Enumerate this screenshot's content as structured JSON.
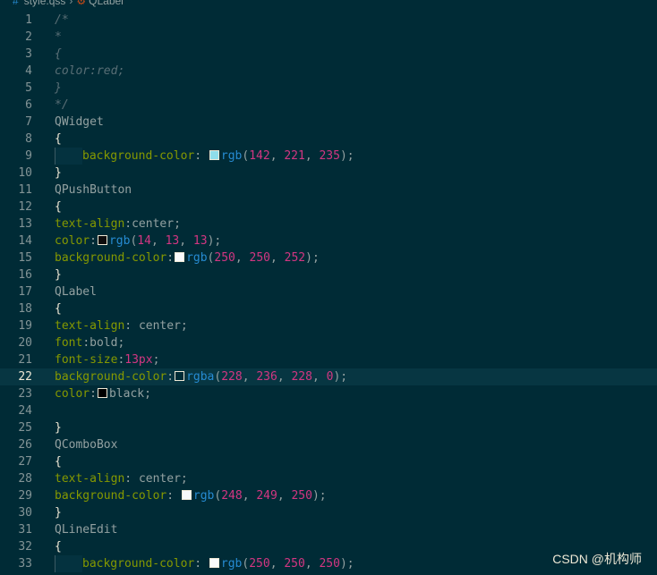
{
  "breadcrumb": {
    "hash": "#",
    "file": "style.qss",
    "symbol": "QLabel"
  },
  "watermark": "CSDN @机构师",
  "colors": {
    "background": "#002b36",
    "current_line": "#073642",
    "comment": "#586e75",
    "property": "#859900",
    "function": "#268bd2",
    "number": "#d33682"
  },
  "lines": [
    {
      "n": "1",
      "tokens": [
        {
          "t": "/*",
          "c": "comment"
        }
      ]
    },
    {
      "n": "2",
      "tokens": [
        {
          "t": "*",
          "c": "comment"
        }
      ]
    },
    {
      "n": "3",
      "tokens": [
        {
          "t": "{",
          "c": "comment"
        }
      ]
    },
    {
      "n": "4",
      "tokens": [
        {
          "t": "color:red;",
          "c": "comment"
        }
      ]
    },
    {
      "n": "5",
      "tokens": [
        {
          "t": "}",
          "c": "comment"
        }
      ]
    },
    {
      "n": "6",
      "tokens": [
        {
          "t": "*/",
          "c": "comment"
        }
      ]
    },
    {
      "n": "7",
      "tokens": [
        {
          "t": "QWidget",
          "c": "sel"
        }
      ]
    },
    {
      "n": "8",
      "tokens": [
        {
          "t": "{",
          "c": "brace"
        }
      ]
    },
    {
      "n": "9",
      "indent": true,
      "tokens": [
        {
          "t": "background-color",
          "c": "prop"
        },
        {
          "t": ": ",
          "c": "punc"
        },
        {
          "swatch": "#8eddeb"
        },
        {
          "t": "rgb",
          "c": "fn"
        },
        {
          "t": "(",
          "c": "punc"
        },
        {
          "t": "142",
          "c": "num"
        },
        {
          "t": ", ",
          "c": "punc"
        },
        {
          "t": "221",
          "c": "num"
        },
        {
          "t": ", ",
          "c": "punc"
        },
        {
          "t": "235",
          "c": "num"
        },
        {
          "t": ");",
          "c": "punc"
        }
      ]
    },
    {
      "n": "10",
      "tokens": [
        {
          "t": "}",
          "c": "brace"
        }
      ]
    },
    {
      "n": "11",
      "tokens": [
        {
          "t": "QPushButton",
          "c": "sel"
        }
      ]
    },
    {
      "n": "12",
      "tokens": [
        {
          "t": "{",
          "c": "brace"
        }
      ]
    },
    {
      "n": "13",
      "tokens": [
        {
          "t": "text-align",
          "c": "prop"
        },
        {
          "t": ":",
          "c": "punc"
        },
        {
          "t": "center",
          "c": "val"
        },
        {
          "t": ";",
          "c": "punc"
        }
      ]
    },
    {
      "n": "14",
      "tokens": [
        {
          "t": "color",
          "c": "prop"
        },
        {
          "t": ":",
          "c": "punc"
        },
        {
          "swatch": "#0e0d0d"
        },
        {
          "t": "rgb",
          "c": "fn"
        },
        {
          "t": "(",
          "c": "punc"
        },
        {
          "t": "14",
          "c": "num"
        },
        {
          "t": ", ",
          "c": "punc"
        },
        {
          "t": "13",
          "c": "num"
        },
        {
          "t": ", ",
          "c": "punc"
        },
        {
          "t": "13",
          "c": "num"
        },
        {
          "t": ");",
          "c": "punc"
        }
      ]
    },
    {
      "n": "15",
      "tokens": [
        {
          "t": "background-color",
          "c": "prop"
        },
        {
          "t": ":",
          "c": "punc"
        },
        {
          "swatch": "#fafafc"
        },
        {
          "t": "rgb",
          "c": "fn"
        },
        {
          "t": "(",
          "c": "punc"
        },
        {
          "t": "250",
          "c": "num"
        },
        {
          "t": ", ",
          "c": "punc"
        },
        {
          "t": "250",
          "c": "num"
        },
        {
          "t": ", ",
          "c": "punc"
        },
        {
          "t": "252",
          "c": "num"
        },
        {
          "t": ");",
          "c": "punc"
        }
      ]
    },
    {
      "n": "16",
      "tokens": [
        {
          "t": "}",
          "c": "brace"
        }
      ]
    },
    {
      "n": "17",
      "tokens": [
        {
          "t": "QLabel",
          "c": "sel"
        }
      ]
    },
    {
      "n": "18",
      "tokens": [
        {
          "t": "{",
          "c": "brace"
        }
      ]
    },
    {
      "n": "19",
      "tokens": [
        {
          "t": "text-align",
          "c": "prop"
        },
        {
          "t": ": ",
          "c": "punc"
        },
        {
          "t": "center",
          "c": "val"
        },
        {
          "t": ";",
          "c": "punc"
        }
      ]
    },
    {
      "n": "20",
      "tokens": [
        {
          "t": "font",
          "c": "prop"
        },
        {
          "t": ":",
          "c": "punc"
        },
        {
          "t": "bold",
          "c": "val"
        },
        {
          "t": ";",
          "c": "punc"
        }
      ]
    },
    {
      "n": "21",
      "tokens": [
        {
          "t": "font-size",
          "c": "prop"
        },
        {
          "t": ":",
          "c": "punc"
        },
        {
          "t": "13px",
          "c": "num"
        },
        {
          "t": ";",
          "c": "punc"
        }
      ]
    },
    {
      "n": "22",
      "current": true,
      "tokens": [
        {
          "t": "background-color",
          "c": "prop"
        },
        {
          "t": ":",
          "c": "punc"
        },
        {
          "swatch": "#002b36"
        },
        {
          "t": "rgba",
          "c": "fn"
        },
        {
          "t": "(",
          "c": "punc"
        },
        {
          "t": "228",
          "c": "num"
        },
        {
          "t": ", ",
          "c": "punc"
        },
        {
          "t": "236",
          "c": "num"
        },
        {
          "t": ", ",
          "c": "punc"
        },
        {
          "t": "228",
          "c": "num"
        },
        {
          "t": ", ",
          "c": "punc"
        },
        {
          "t": "0",
          "c": "num"
        },
        {
          "t": ");",
          "c": "punc"
        }
      ]
    },
    {
      "n": "23",
      "tokens": [
        {
          "t": "color",
          "c": "prop"
        },
        {
          "t": ":",
          "c": "punc"
        },
        {
          "swatch": "#000000"
        },
        {
          "t": "black",
          "c": "val"
        },
        {
          "t": ";",
          "c": "punc"
        }
      ]
    },
    {
      "n": "24",
      "tokens": []
    },
    {
      "n": "25",
      "tokens": [
        {
          "t": "}",
          "c": "brace"
        }
      ]
    },
    {
      "n": "26",
      "tokens": [
        {
          "t": "QComboBox",
          "c": "sel"
        }
      ]
    },
    {
      "n": "27",
      "tokens": [
        {
          "t": "{",
          "c": "brace"
        }
      ]
    },
    {
      "n": "28",
      "tokens": [
        {
          "t": "text-align",
          "c": "prop"
        },
        {
          "t": ": ",
          "c": "punc"
        },
        {
          "t": "center",
          "c": "val"
        },
        {
          "t": ";",
          "c": "punc"
        }
      ]
    },
    {
      "n": "29",
      "tokens": [
        {
          "t": "background-color",
          "c": "prop"
        },
        {
          "t": ": ",
          "c": "punc"
        },
        {
          "swatch": "#f8f9fa"
        },
        {
          "t": "rgb",
          "c": "fn"
        },
        {
          "t": "(",
          "c": "punc"
        },
        {
          "t": "248",
          "c": "num"
        },
        {
          "t": ", ",
          "c": "punc"
        },
        {
          "t": "249",
          "c": "num"
        },
        {
          "t": ", ",
          "c": "punc"
        },
        {
          "t": "250",
          "c": "num"
        },
        {
          "t": ");",
          "c": "punc"
        }
      ]
    },
    {
      "n": "30",
      "tokens": [
        {
          "t": "}",
          "c": "brace"
        }
      ]
    },
    {
      "n": "31",
      "tokens": [
        {
          "t": "QLineEdit",
          "c": "sel"
        }
      ]
    },
    {
      "n": "32",
      "tokens": [
        {
          "t": "{",
          "c": "brace"
        }
      ]
    },
    {
      "n": "33",
      "indent": true,
      "tokens": [
        {
          "t": "background-color",
          "c": "prop"
        },
        {
          "t": ": ",
          "c": "punc"
        },
        {
          "swatch": "#fafafa"
        },
        {
          "t": "rgb",
          "c": "fn"
        },
        {
          "t": "(",
          "c": "punc"
        },
        {
          "t": "250",
          "c": "num"
        },
        {
          "t": ", ",
          "c": "punc"
        },
        {
          "t": "250",
          "c": "num"
        },
        {
          "t": ", ",
          "c": "punc"
        },
        {
          "t": "250",
          "c": "num"
        },
        {
          "t": ");",
          "c": "punc"
        }
      ]
    }
  ]
}
